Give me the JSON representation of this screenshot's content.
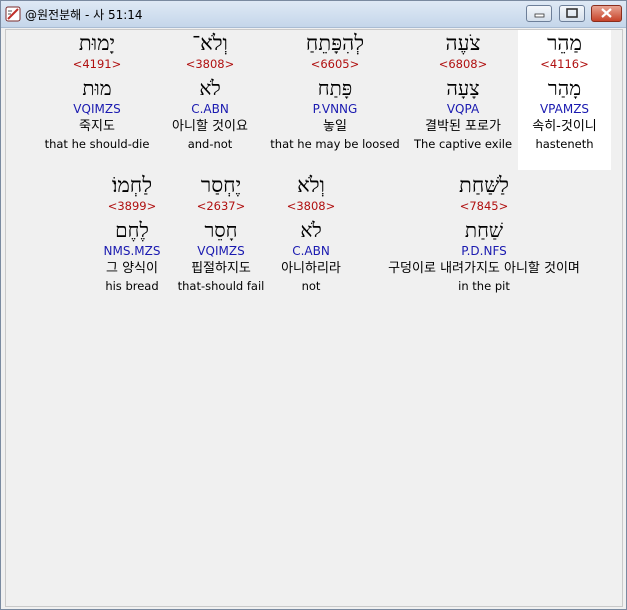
{
  "window": {
    "title": "@원전분해 - 사 51:14",
    "app_icon": "scroll-pen-icon",
    "controls": [
      "minimize-icon",
      "maximize-icon",
      "close-icon"
    ]
  },
  "rows": [
    [
      {
        "hebrew": "מַהֵר",
        "strong": "<4116>",
        "lemma": "מָהַר",
        "morph": "VPAMZS",
        "korean": "속히-것이니",
        "english": "hasteneth",
        "selected": true
      },
      {
        "hebrew": "צֹעֶה",
        "strong": "<6808>",
        "lemma": "צָעָה",
        "morph": "VQPA",
        "korean": "결박된 포로가",
        "english": "The captive exile",
        "selected": false
      },
      {
        "hebrew": "לְהִפָּתֵחַ",
        "strong": "<6605>",
        "lemma": "פָּתַח",
        "morph": "P.VNNG",
        "korean": "놓일",
        "english": "that he may be loosed",
        "selected": false
      },
      {
        "hebrew": "וְלֹא־",
        "strong": "<3808>",
        "lemma": "לֹא",
        "morph": "C.ABN",
        "korean": "아니할 것이요",
        "english": "and-not",
        "selected": false
      },
      {
        "hebrew": "יָמוּת",
        "strong": "<4191>",
        "lemma": "מוּת",
        "morph": "VQIMZS",
        "korean": "죽지도",
        "english": "that he should-die",
        "selected": false
      }
    ],
    [
      {
        "hebrew": "לַשַּׁחַת",
        "strong": "<7845>",
        "lemma": "שַׁחַת",
        "morph": "P.D.NFS",
        "korean": "구덩이로 내려가지도 아니할 것이며",
        "english": "in the pit",
        "selected": false
      },
      {
        "hebrew": "וְלֹא",
        "strong": "<3808>",
        "lemma": "לֹא",
        "morph": "C.ABN",
        "korean": "아니하리라",
        "english": "not",
        "selected": false
      },
      {
        "hebrew": "יֶחְסַר",
        "strong": "<2637>",
        "lemma": "חָסֵר",
        "morph": "VQIMZS",
        "korean": "핍절하지도",
        "english": "that-should fail",
        "selected": false
      },
      {
        "hebrew": "לַחְמוֹ׃",
        "strong": "<3899>",
        "lemma": "לֶחֶם",
        "morph": "NMS.MZS",
        "korean": "그 양식이",
        "english": "his bread",
        "selected": false
      }
    ]
  ]
}
